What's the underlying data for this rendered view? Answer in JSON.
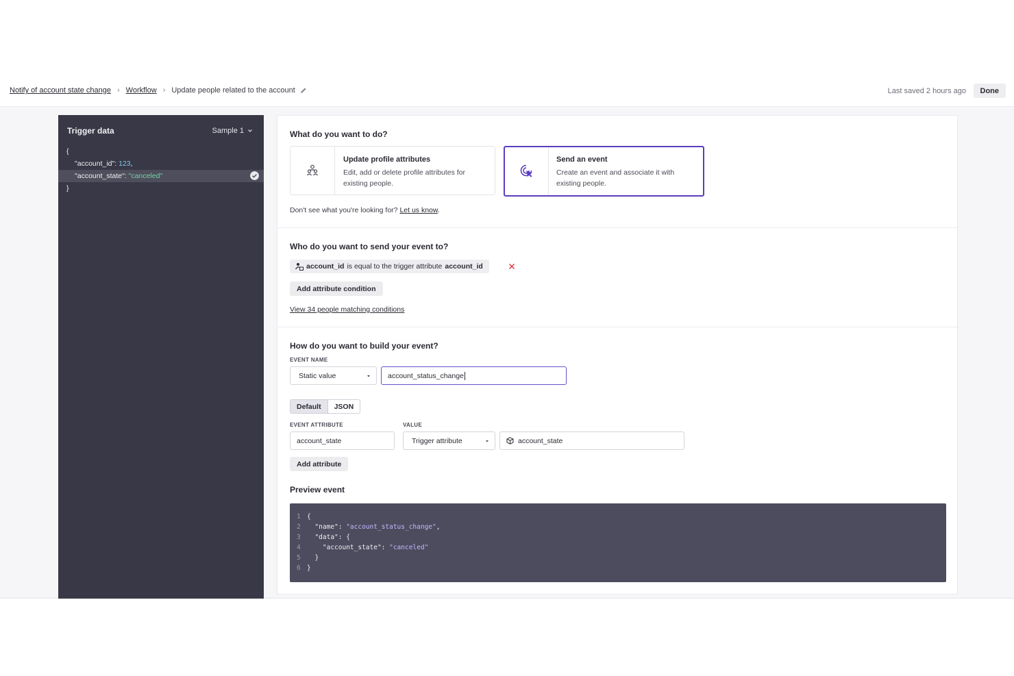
{
  "breadcrumb": {
    "items": [
      "Notify of account state change",
      "Workflow"
    ],
    "current": "Update people related to the account"
  },
  "header": {
    "last_saved": "Last saved 2 hours ago",
    "done_label": "Done"
  },
  "trigger": {
    "title": "Trigger data",
    "sample": "Sample 1",
    "lines": {
      "open": "{",
      "k1": "\"account_id\": ",
      "v1": "123",
      "c1": ",",
      "k2": "\"account_state\": ",
      "v2": "\"canceled\"",
      "close": "}"
    }
  },
  "action": {
    "question": "What do you want to do?",
    "cards": [
      {
        "title": "Update profile attributes",
        "desc": "Edit, add or delete profile attributes for existing people."
      },
      {
        "title": "Send an event",
        "desc": "Create an event and associate it with existing people."
      }
    ],
    "help_text": "Don't see what you're looking for? ",
    "help_link": "Let us know",
    "help_end": "."
  },
  "audience": {
    "question": "Who do you want to send your event to?",
    "cond_attr": "account_id",
    "cond_mid": " is equal to the trigger attribute ",
    "cond_val": "account_id",
    "add_condition": "Add attribute condition",
    "view_link": "View 34 people matching conditions"
  },
  "build": {
    "question": "How do you want to build your event?",
    "event_name_label": "EVENT NAME",
    "name_source": "Static value",
    "name_value": "account_status_change",
    "tabs": [
      "Default",
      "JSON"
    ],
    "attr_label": "EVENT ATTRIBUTE",
    "value_label": "VALUE",
    "attr_name": "account_state",
    "value_source": "Trigger attribute",
    "value_attr": "account_state",
    "add_attribute": "Add attribute",
    "preview_title": "Preview event",
    "preview": {
      "n1": "1",
      "l1": "{",
      "n2": "2",
      "l2k": "  \"name\": ",
      "l2v": "\"account_status_change\"",
      "l2e": ",",
      "n3": "3",
      "l3": "  \"data\": {",
      "n4": "4",
      "l4k": "    \"account_state\": ",
      "l4v": "\"canceled\"",
      "n5": "5",
      "l5": "  }",
      "n6": "6",
      "l6": "}"
    }
  },
  "colors": {
    "accent": "#5a3dbf",
    "panel_dark": "#383846",
    "code_bg": "#4c4c5e",
    "remove_red": "#d9343b"
  }
}
